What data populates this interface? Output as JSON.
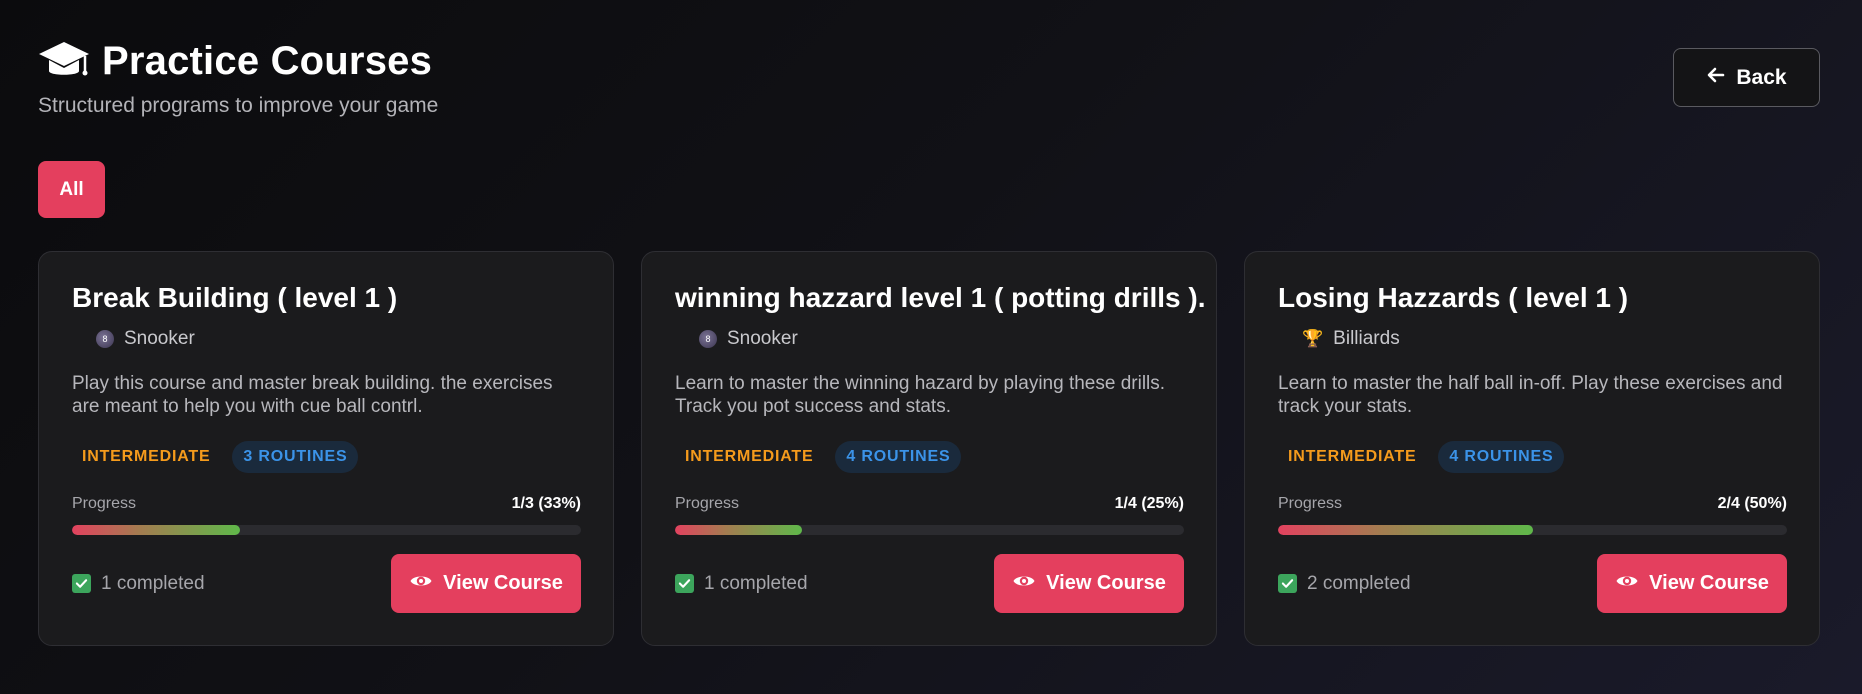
{
  "header": {
    "icon": "graduation-cap-icon",
    "title": "Practice Courses",
    "subtitle": "Structured programs to improve your game"
  },
  "back_button": {
    "icon": "arrow-left-icon",
    "label": "Back"
  },
  "filters": [
    {
      "label": "All",
      "active": true
    }
  ],
  "colors": {
    "accent": "#e43f5e",
    "level": "#f59b1c",
    "routines": "#3b93e8",
    "success": "#3ca55c"
  },
  "courses": [
    {
      "title": "Break Building ( level 1 )",
      "sport_icon": "eight-ball-icon",
      "sport": "Snooker",
      "description": "Play this course and master break building. the exercises are meant to help you with cue ball contrl.",
      "level": "INTERMEDIATE",
      "routines": "3 ROUTINES",
      "progress_label": "Progress",
      "progress_text": "1/3 (33%)",
      "progress_fraction": 0.33,
      "completed": "1 completed",
      "button": "View Course"
    },
    {
      "title": "winning hazzard level 1 ( potting drills ).",
      "sport_icon": "eight-ball-icon",
      "sport": "Snooker",
      "description": "Learn to master the winning hazard by playing these drills. Track you pot success and stats.",
      "level": "INTERMEDIATE",
      "routines": "4 ROUTINES",
      "progress_label": "Progress",
      "progress_text": "1/4 (25%)",
      "progress_fraction": 0.25,
      "completed": "1 completed",
      "button": "View Course"
    },
    {
      "title": "Losing Hazzards ( level 1 )",
      "sport_icon": "trophy-icon",
      "sport": "Billiards",
      "description": "Learn to master the half ball in-off. Play these exercises and track your stats.",
      "level": "INTERMEDIATE",
      "routines": "4 ROUTINES",
      "progress_label": "Progress",
      "progress_text": "2/4 (50%)",
      "progress_fraction": 0.5,
      "completed": "2 completed",
      "button": "View Course"
    }
  ]
}
